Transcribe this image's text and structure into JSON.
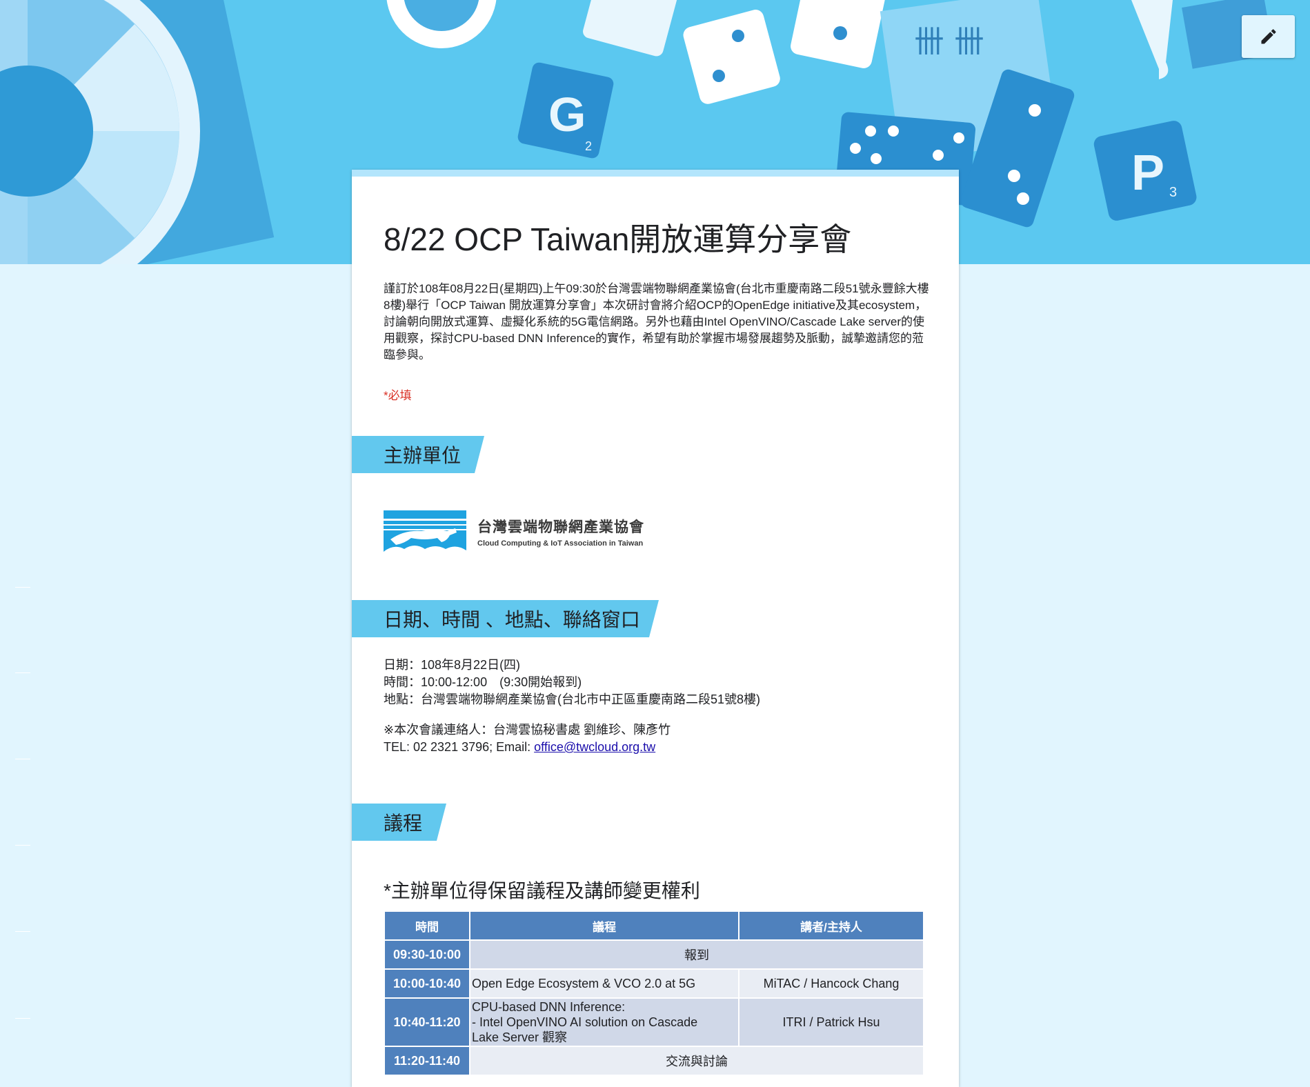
{
  "form": {
    "title": "8/22 OCP Taiwan開放運算分享會",
    "description": "謹訂於108年08月22日(星期四)上午09:30於台灣雲端物聯網產業協會(台北市重慶南路二段51號永豐餘大樓8樓)舉行「OCP Taiwan 開放運算分享會」本次研討會將介紹OCP的OpenEdge initiative及其ecosystem，討論朝向開放式運算、虛擬化系統的5G電信網路。另外也藉由Intel OpenVINO/Cascade Lake server的使用觀察，探討CPU-based DNN Inference的實作，希望有助於掌握市場發展趨勢及脈動，誠摯邀請您的蒞臨參與。",
    "required_note": "*必填"
  },
  "toolbar": {
    "edit_icon": "pencil-icon"
  },
  "sections": {
    "organizer": "主辦單位",
    "info": "日期、時間 、地點、聯絡窗口",
    "agenda": "議程"
  },
  "logo": {
    "name_zh": "台灣雲端物聯網產業協會",
    "name_en": "Cloud Computing & IoT Association in Taiwan"
  },
  "info": {
    "date": "日期：108年8月22日(四)",
    "time": "時間：10:00-12:00　(9:30開始報到)",
    "location": "地點：台灣雲端物聯網產業協會(台北市中正區重慶南路二段51號8樓)",
    "contact": "※本次會議連絡人：台灣雲協秘書處 劉維珍、陳彥竹",
    "tel": "TEL: 02 2321 3796;  Email: ",
    "email": "office@twcloud.org.tw"
  },
  "notice": "*主辦單位得保留議程及講師變更權利",
  "agenda_table": {
    "headers": [
      "時間",
      "議程",
      "講者/主持人"
    ],
    "rows": [
      {
        "time": "09:30-10:00",
        "topic": "報到",
        "speaker": ""
      },
      {
        "time": "10:00-10:40",
        "topic": "Open Edge Ecosystem & VCO 2.0 at 5G",
        "speaker": "MiTAC / Hancock Chang"
      },
      {
        "time": "10:40-11:20",
        "topic_lines": [
          "CPU-based DNN Inference:",
          "- Intel OpenVINO AI solution on Cascade",
          "Lake Server 觀察"
        ],
        "speaker": "ITRI / Patrick Hsu"
      },
      {
        "time": "11:20-11:40",
        "topic": "交流與討論",
        "speaker": ""
      }
    ]
  },
  "colors": {
    "banner": "#5bc8f0",
    "page_background": "#e1f5fe",
    "section_header": "#62c8ee",
    "table_header": "#4f81bd",
    "required": "#d93025"
  }
}
